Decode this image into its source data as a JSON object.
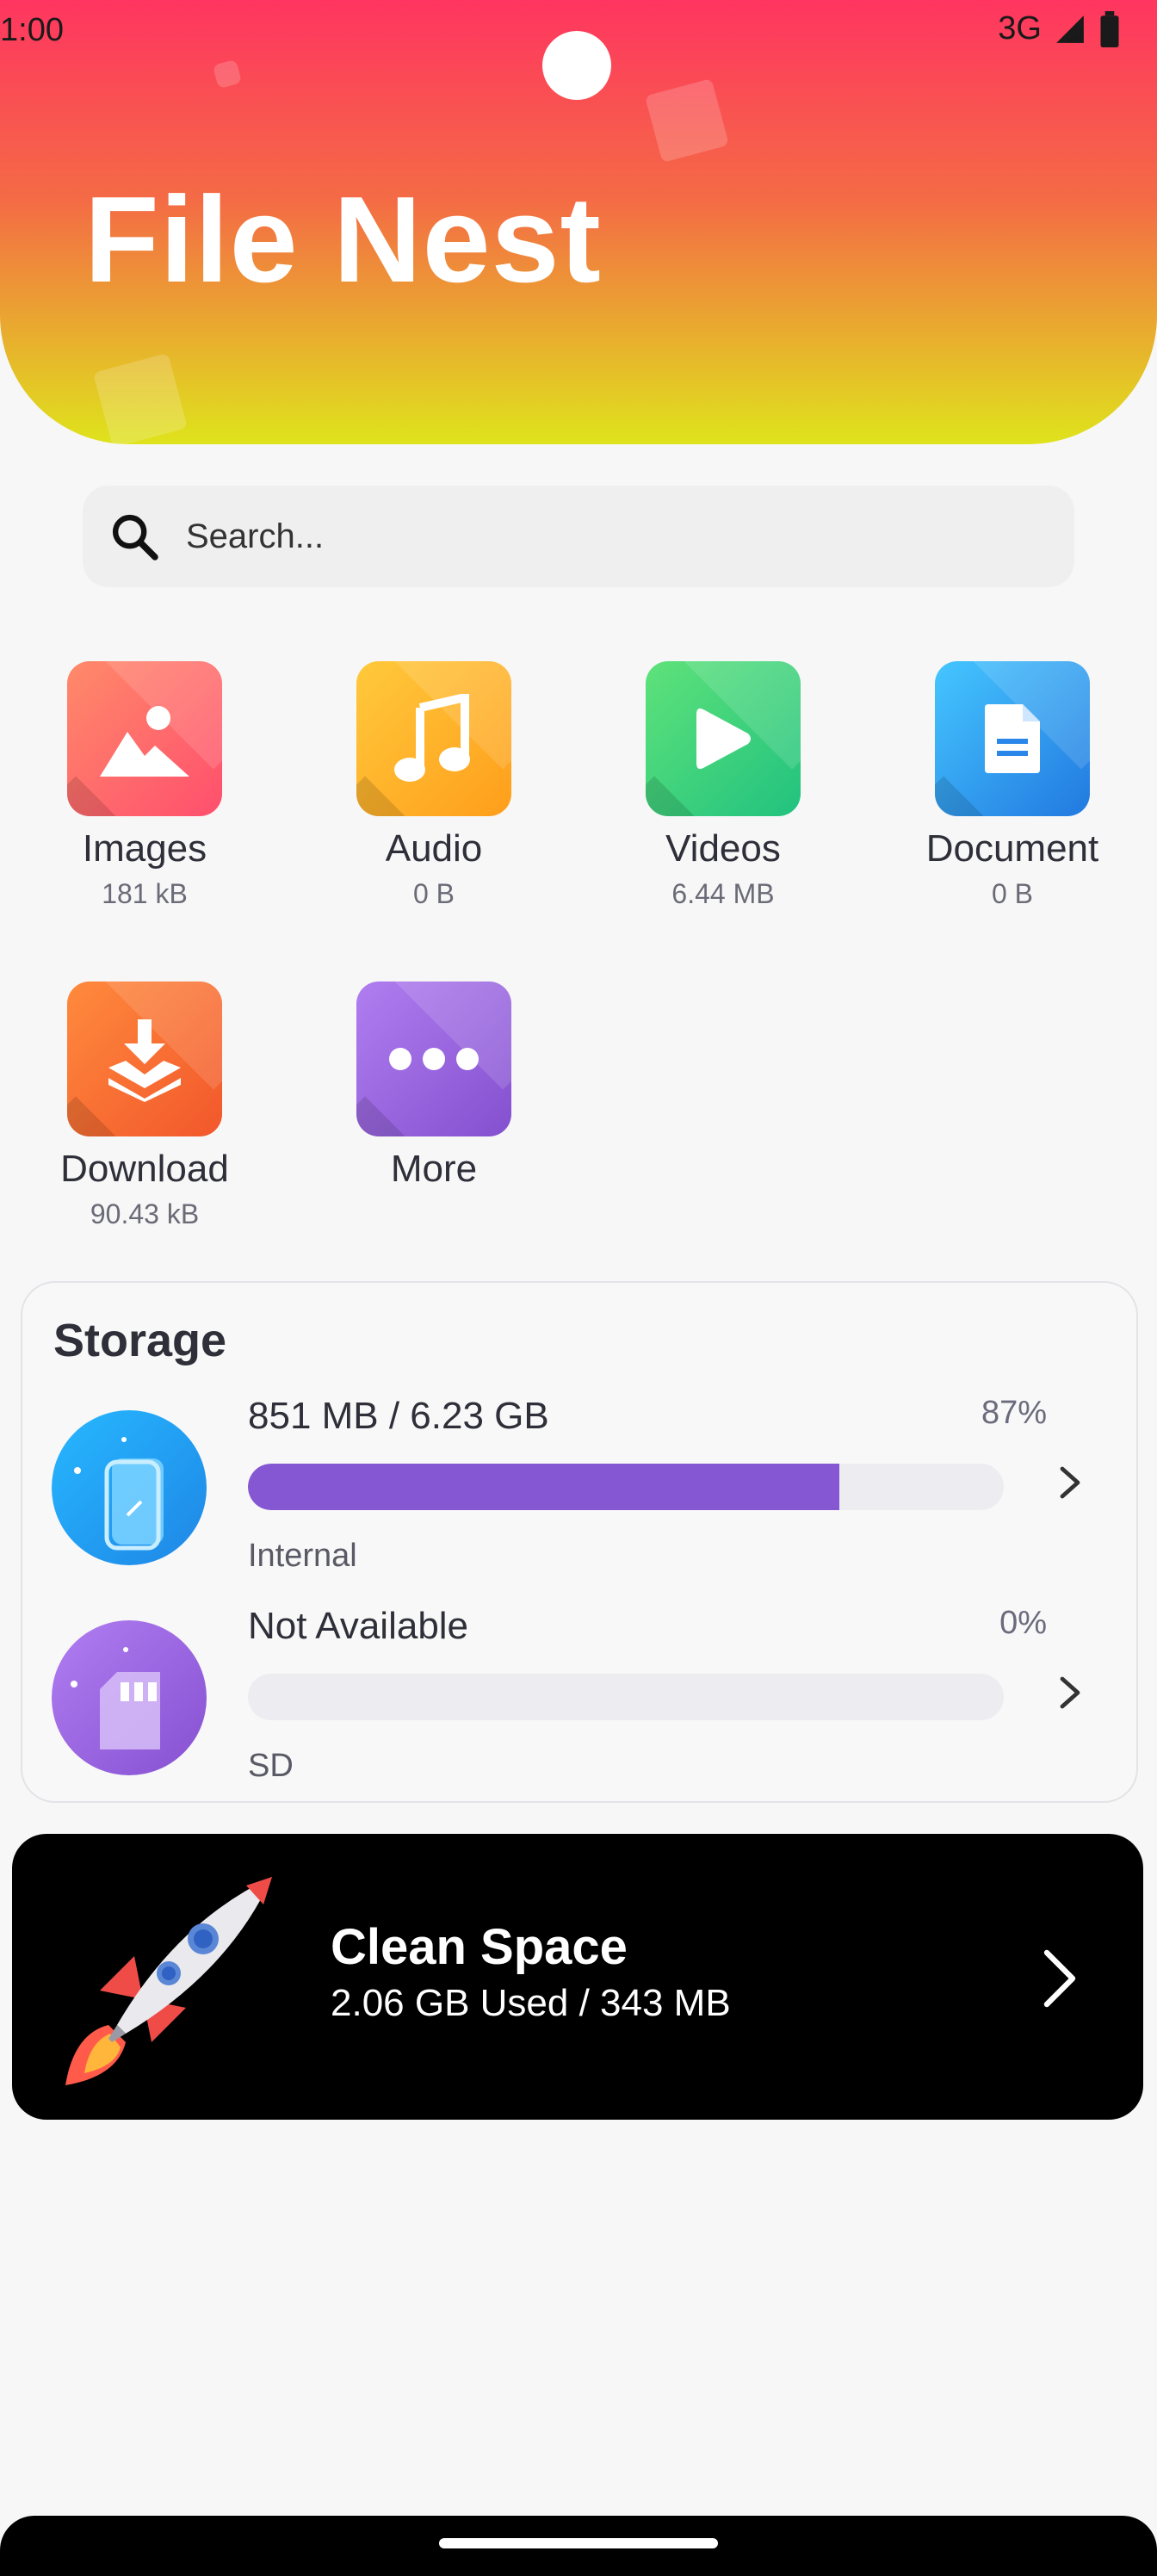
{
  "status_bar": {
    "time": "1:00",
    "network": "3G"
  },
  "app": {
    "title": "File Nest"
  },
  "search": {
    "placeholder": "Search..."
  },
  "categories": [
    {
      "name": "Images",
      "size": "181 kB",
      "icon": "image-icon",
      "color": "#ff5f6d"
    },
    {
      "name": "Audio",
      "size": "0 B",
      "icon": "music-note-icon",
      "color": "#ffad1f"
    },
    {
      "name": "Videos",
      "size": "6.44 MB",
      "icon": "play-icon",
      "color": "#34c97a"
    },
    {
      "name": "Document",
      "size": "0 B",
      "icon": "document-icon",
      "color": "#2d9bf0"
    },
    {
      "name": "Download",
      "size": "90.43 kB",
      "icon": "download-icon",
      "color": "#ff6a2a"
    },
    {
      "name": "More",
      "size": "",
      "icon": "more-dots-icon",
      "color": "#8f5bd8"
    }
  ],
  "storage": {
    "title": "Storage",
    "items": [
      {
        "primary": "851 MB / 6.23 GB",
        "percent_text": "87%",
        "percent": 87,
        "label": "Internal",
        "icon": "phone-icon"
      },
      {
        "primary": "Not Available",
        "percent_text": "0%",
        "percent": 0,
        "label": "SD",
        "icon": "sd-card-icon"
      }
    ]
  },
  "clean": {
    "title": "Clean Space",
    "subtitle": "2.06 GB Used / 343 MB",
    "icon": "rocket-icon"
  },
  "colors": {
    "accent": "#8557d3",
    "header_top": "#ff3560",
    "header_bottom": "#dfe31c"
  }
}
